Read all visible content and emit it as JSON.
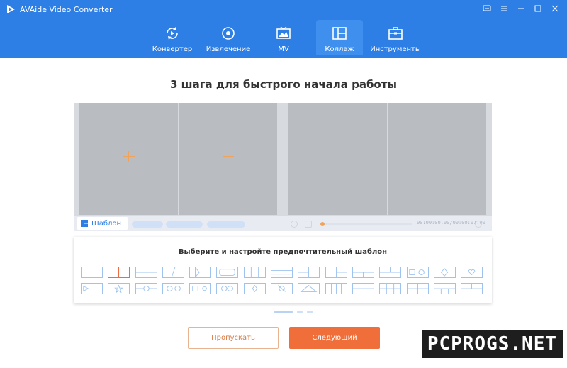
{
  "app": {
    "title": "AVAide Video Converter"
  },
  "tabs": [
    {
      "label": "Конвертер",
      "icon": "convert-icon"
    },
    {
      "label": "Извлечение",
      "icon": "ripper-icon"
    },
    {
      "label": "MV",
      "icon": "mv-icon"
    },
    {
      "label": "Коллаж",
      "icon": "collage-icon",
      "active": true
    },
    {
      "label": "Инструменты",
      "icon": "toolbox-icon"
    }
  ],
  "main": {
    "heading": "3 шага для быстрого начала работы",
    "template_tab_label": "Шаблон",
    "timecode": "00:00:00.00/00:00:01.00",
    "template_panel_title": "Выберите и настройте предпочтительный шаблон",
    "skip_label": "Пропускать",
    "next_label": "Следующий"
  },
  "watermark": "PCPROGS.NET",
  "colors": {
    "header": "#2d7fe6",
    "accent": "#ef6e3a",
    "template_border": "#9ec3ef"
  }
}
